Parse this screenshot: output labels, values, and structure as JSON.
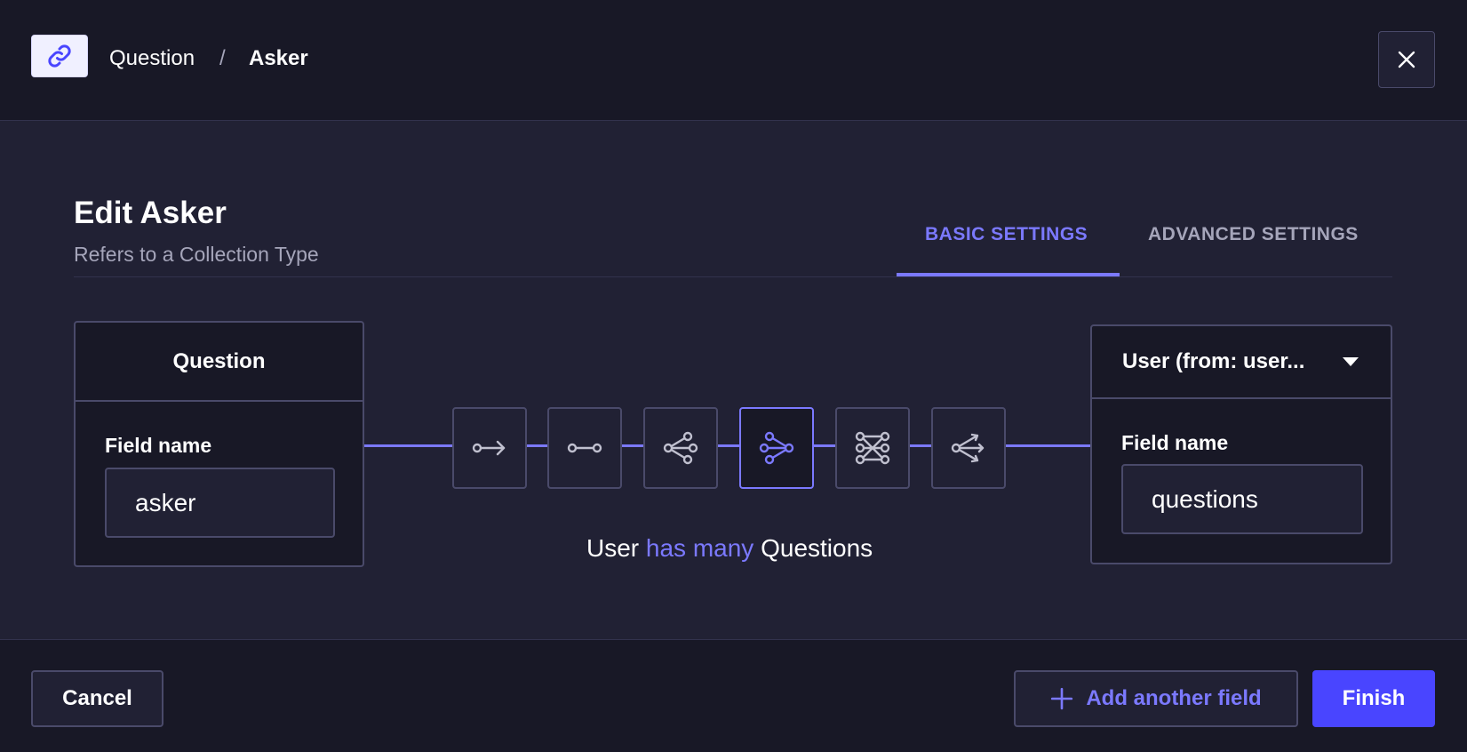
{
  "colors": {
    "accent": "#7b79ff",
    "primary": "#4945ff",
    "background": "#212134",
    "surface": "#181826",
    "border": "#4a4a6a"
  },
  "header": {
    "badge_icon": "link-icon",
    "breadcrumb": [
      "Question",
      "/",
      "Asker"
    ],
    "close_icon": "close-icon"
  },
  "main": {
    "title": "Edit Asker",
    "subtitle": "Refers to a Collection Type",
    "tabs": [
      {
        "label": "BASIC SETTINGS",
        "active": true
      },
      {
        "label": "ADVANCED SETTINGS",
        "active": false
      }
    ]
  },
  "left_box": {
    "header": "Question",
    "field_label": "Field name",
    "field_value": "asker"
  },
  "right_box": {
    "select_value": "User (from: user...",
    "field_label": "Field name",
    "field_value": "questions"
  },
  "relations": [
    {
      "icon": "one-way-relation-icon",
      "active": false
    },
    {
      "icon": "one-to-one-relation-icon",
      "active": false
    },
    {
      "icon": "one-to-many-relation-icon",
      "active": false
    },
    {
      "icon": "many-to-one-relation-icon",
      "active": true
    },
    {
      "icon": "many-to-many-relation-icon",
      "active": false
    },
    {
      "icon": "many-way-relation-icon",
      "active": false
    }
  ],
  "relation_text": {
    "subject": "User",
    "verb": "has many",
    "object": "Questions"
  },
  "footer": {
    "cancel_label": "Cancel",
    "add_label": "Add another field",
    "add_icon": "plus-icon",
    "finish_label": "Finish"
  }
}
